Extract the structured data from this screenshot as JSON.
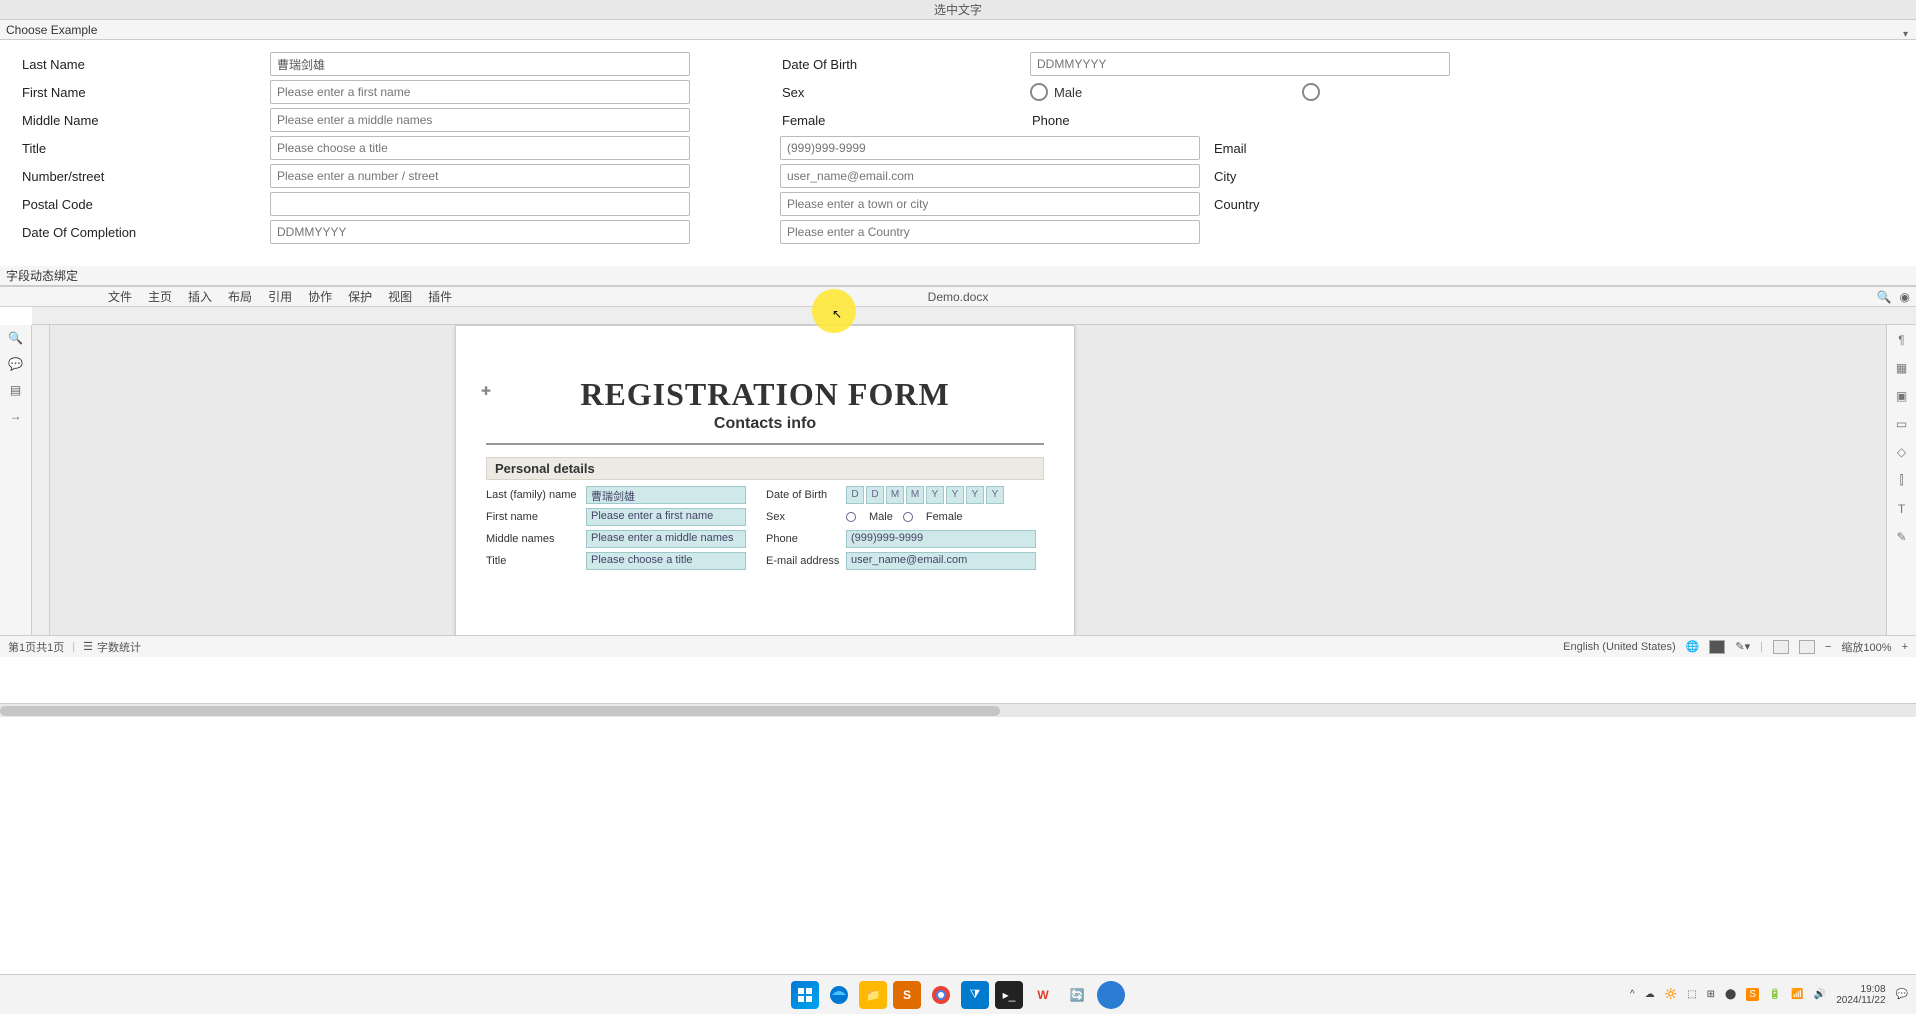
{
  "topbar": {
    "title": "选中文字"
  },
  "choose": {
    "label": "Choose Example"
  },
  "form": {
    "last_name": {
      "label": "Last Name",
      "value": "曹瑞剑雄"
    },
    "first_name": {
      "label": "First Name",
      "placeholder": "Please enter a first name"
    },
    "middle_name": {
      "label": "Middle Name",
      "placeholder": "Please enter a middle names"
    },
    "title": {
      "label": "Title",
      "placeholder": "Please choose a title"
    },
    "number_street": {
      "label": "Number/street",
      "placeholder": "Please enter a number / street"
    },
    "postal_code": {
      "label": "Postal Code",
      "placeholder": ""
    },
    "date_completion": {
      "label": "Date Of Completion",
      "placeholder": "DDMMYYYY"
    },
    "dob": {
      "label": "Date Of Birth",
      "placeholder": "DDMMYYYY"
    },
    "sex": {
      "label": "Sex",
      "male": "Male",
      "female": "Female"
    },
    "phone": {
      "label": "Phone",
      "placeholder": "(999)999-9999"
    },
    "email": {
      "label": "Email",
      "placeholder": "user_name@email.com"
    },
    "city": {
      "label": "City",
      "placeholder": "Please enter a town or city"
    },
    "country": {
      "label": "Country",
      "placeholder": "Please enter a Country"
    }
  },
  "section2": {
    "label": "字段动态绑定"
  },
  "menu": {
    "items": [
      "文件",
      "主页",
      "插入",
      "布局",
      "引用",
      "协作",
      "保护",
      "视图",
      "插件"
    ],
    "docname": "Demo.docx"
  },
  "doc": {
    "title": "REGISTRATION FORM",
    "subtitle": "Contacts info",
    "pd_header": "Personal details",
    "last_l": "Last (family) name",
    "last_v": "曹瑞剑雄",
    "first_l": "First name",
    "first_v": "Please enter a first name",
    "middle_l": "Middle names",
    "middle_v": "Please enter a middle names",
    "title_l": "Title",
    "title_v": "Please choose a title",
    "dob_l": "Date of Birth",
    "dob_cells": [
      "D",
      "D",
      "M",
      "M",
      "Y",
      "Y",
      "Y",
      "Y"
    ],
    "sex_l": "Sex",
    "sex_m": "Male",
    "sex_f": "Female",
    "phone_l": "Phone",
    "phone_v": "(999)999-9999",
    "email_l": "E-mail address",
    "email_v": "user_name@email.com"
  },
  "status": {
    "page": "第1页共1页",
    "wordcount": "字数统计",
    "lang": "English (United States)",
    "zoom": "缩放100%"
  },
  "taskbar": {
    "time": "19:08",
    "date": "2024/11/22"
  }
}
